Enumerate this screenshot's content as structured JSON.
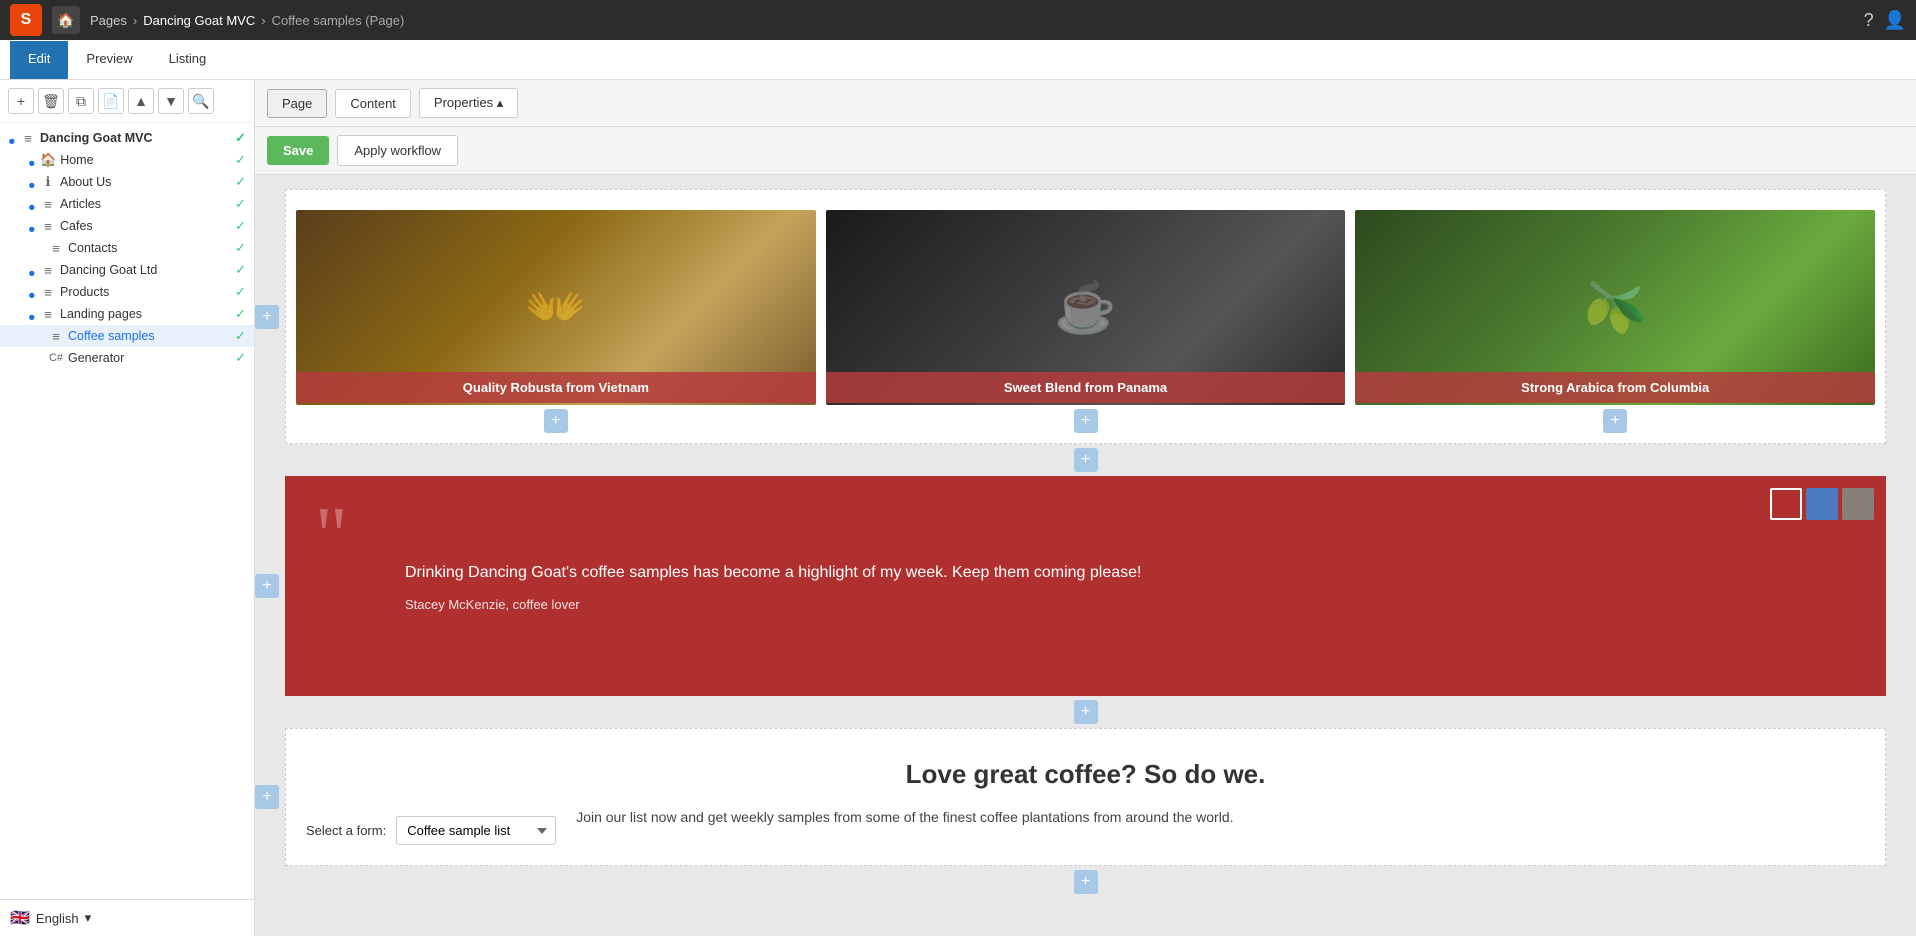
{
  "topbar": {
    "logo_text": "S",
    "site_name": "Dancing Goat MVC",
    "breadcrumb_pages": "Pages",
    "breadcrumb_separator": ">",
    "breadcrumb_current": "Coffee samples (Page)"
  },
  "tabs": {
    "edit_label": "Edit",
    "preview_label": "Preview",
    "listing_label": "Listing"
  },
  "sidebar_toolbar": {
    "add": "+",
    "delete": "🗑",
    "copy": "📋",
    "paste": "📄",
    "up": "▲",
    "down": "▼",
    "search": "🔍"
  },
  "tree": {
    "root": "Dancing Goat MVC",
    "items": [
      {
        "id": "home",
        "label": "Home",
        "icon": "🏠",
        "level": 1
      },
      {
        "id": "about",
        "label": "About Us",
        "icon": "ℹ",
        "level": 1
      },
      {
        "id": "articles",
        "label": "Articles",
        "icon": "≡",
        "level": 1
      },
      {
        "id": "cafes",
        "label": "Cafes",
        "icon": "≡",
        "level": 1
      },
      {
        "id": "contacts",
        "label": "Contacts",
        "icon": "≡",
        "level": 2
      },
      {
        "id": "dancing-goat-ltd",
        "label": "Dancing Goat Ltd",
        "icon": "≡",
        "level": 1
      },
      {
        "id": "products",
        "label": "Products",
        "icon": "≡",
        "level": 1
      },
      {
        "id": "landing-pages",
        "label": "Landing pages",
        "icon": "≡",
        "level": 1
      },
      {
        "id": "coffee-samples",
        "label": "Coffee samples",
        "icon": "≡",
        "level": 2,
        "active": true
      },
      {
        "id": "generator",
        "label": "Generator",
        "icon": "C#",
        "level": 2
      }
    ]
  },
  "page_tabs": {
    "page_label": "Page",
    "content_label": "Content",
    "properties_label": "Properties ▴"
  },
  "actions": {
    "save_label": "Save",
    "workflow_label": "Apply workflow"
  },
  "cards": [
    {
      "id": "vietnam",
      "label": "Quality Robusta from Vietnam"
    },
    {
      "id": "panama",
      "label": "Sweet Blend from Panama"
    },
    {
      "id": "columbia",
      "label": "Strong Arabica from Columbia"
    }
  ],
  "quote": {
    "text": "Drinking Dancing Goat's coffee samples has become a highlight of my week. Keep them coming please!",
    "attribution": "Stacey McKenzie, coffee lover",
    "colors": [
      {
        "id": "red",
        "hex": "#b03030",
        "selected": true
      },
      {
        "id": "blue",
        "hex": "#4a7abf",
        "selected": false
      },
      {
        "id": "gray",
        "hex": "#888077",
        "selected": false
      }
    ]
  },
  "love_section": {
    "heading": "Love great coffee? So do we.",
    "body_text": "Join our list now and get weekly samples from some of the finest coffee plantations from around the world.",
    "form_label": "Select a form:",
    "form_value": "Coffee sample list",
    "form_options": [
      "Coffee sample list"
    ]
  },
  "language": {
    "flag": "🇬🇧",
    "label": "English",
    "dropdown": "▾"
  }
}
